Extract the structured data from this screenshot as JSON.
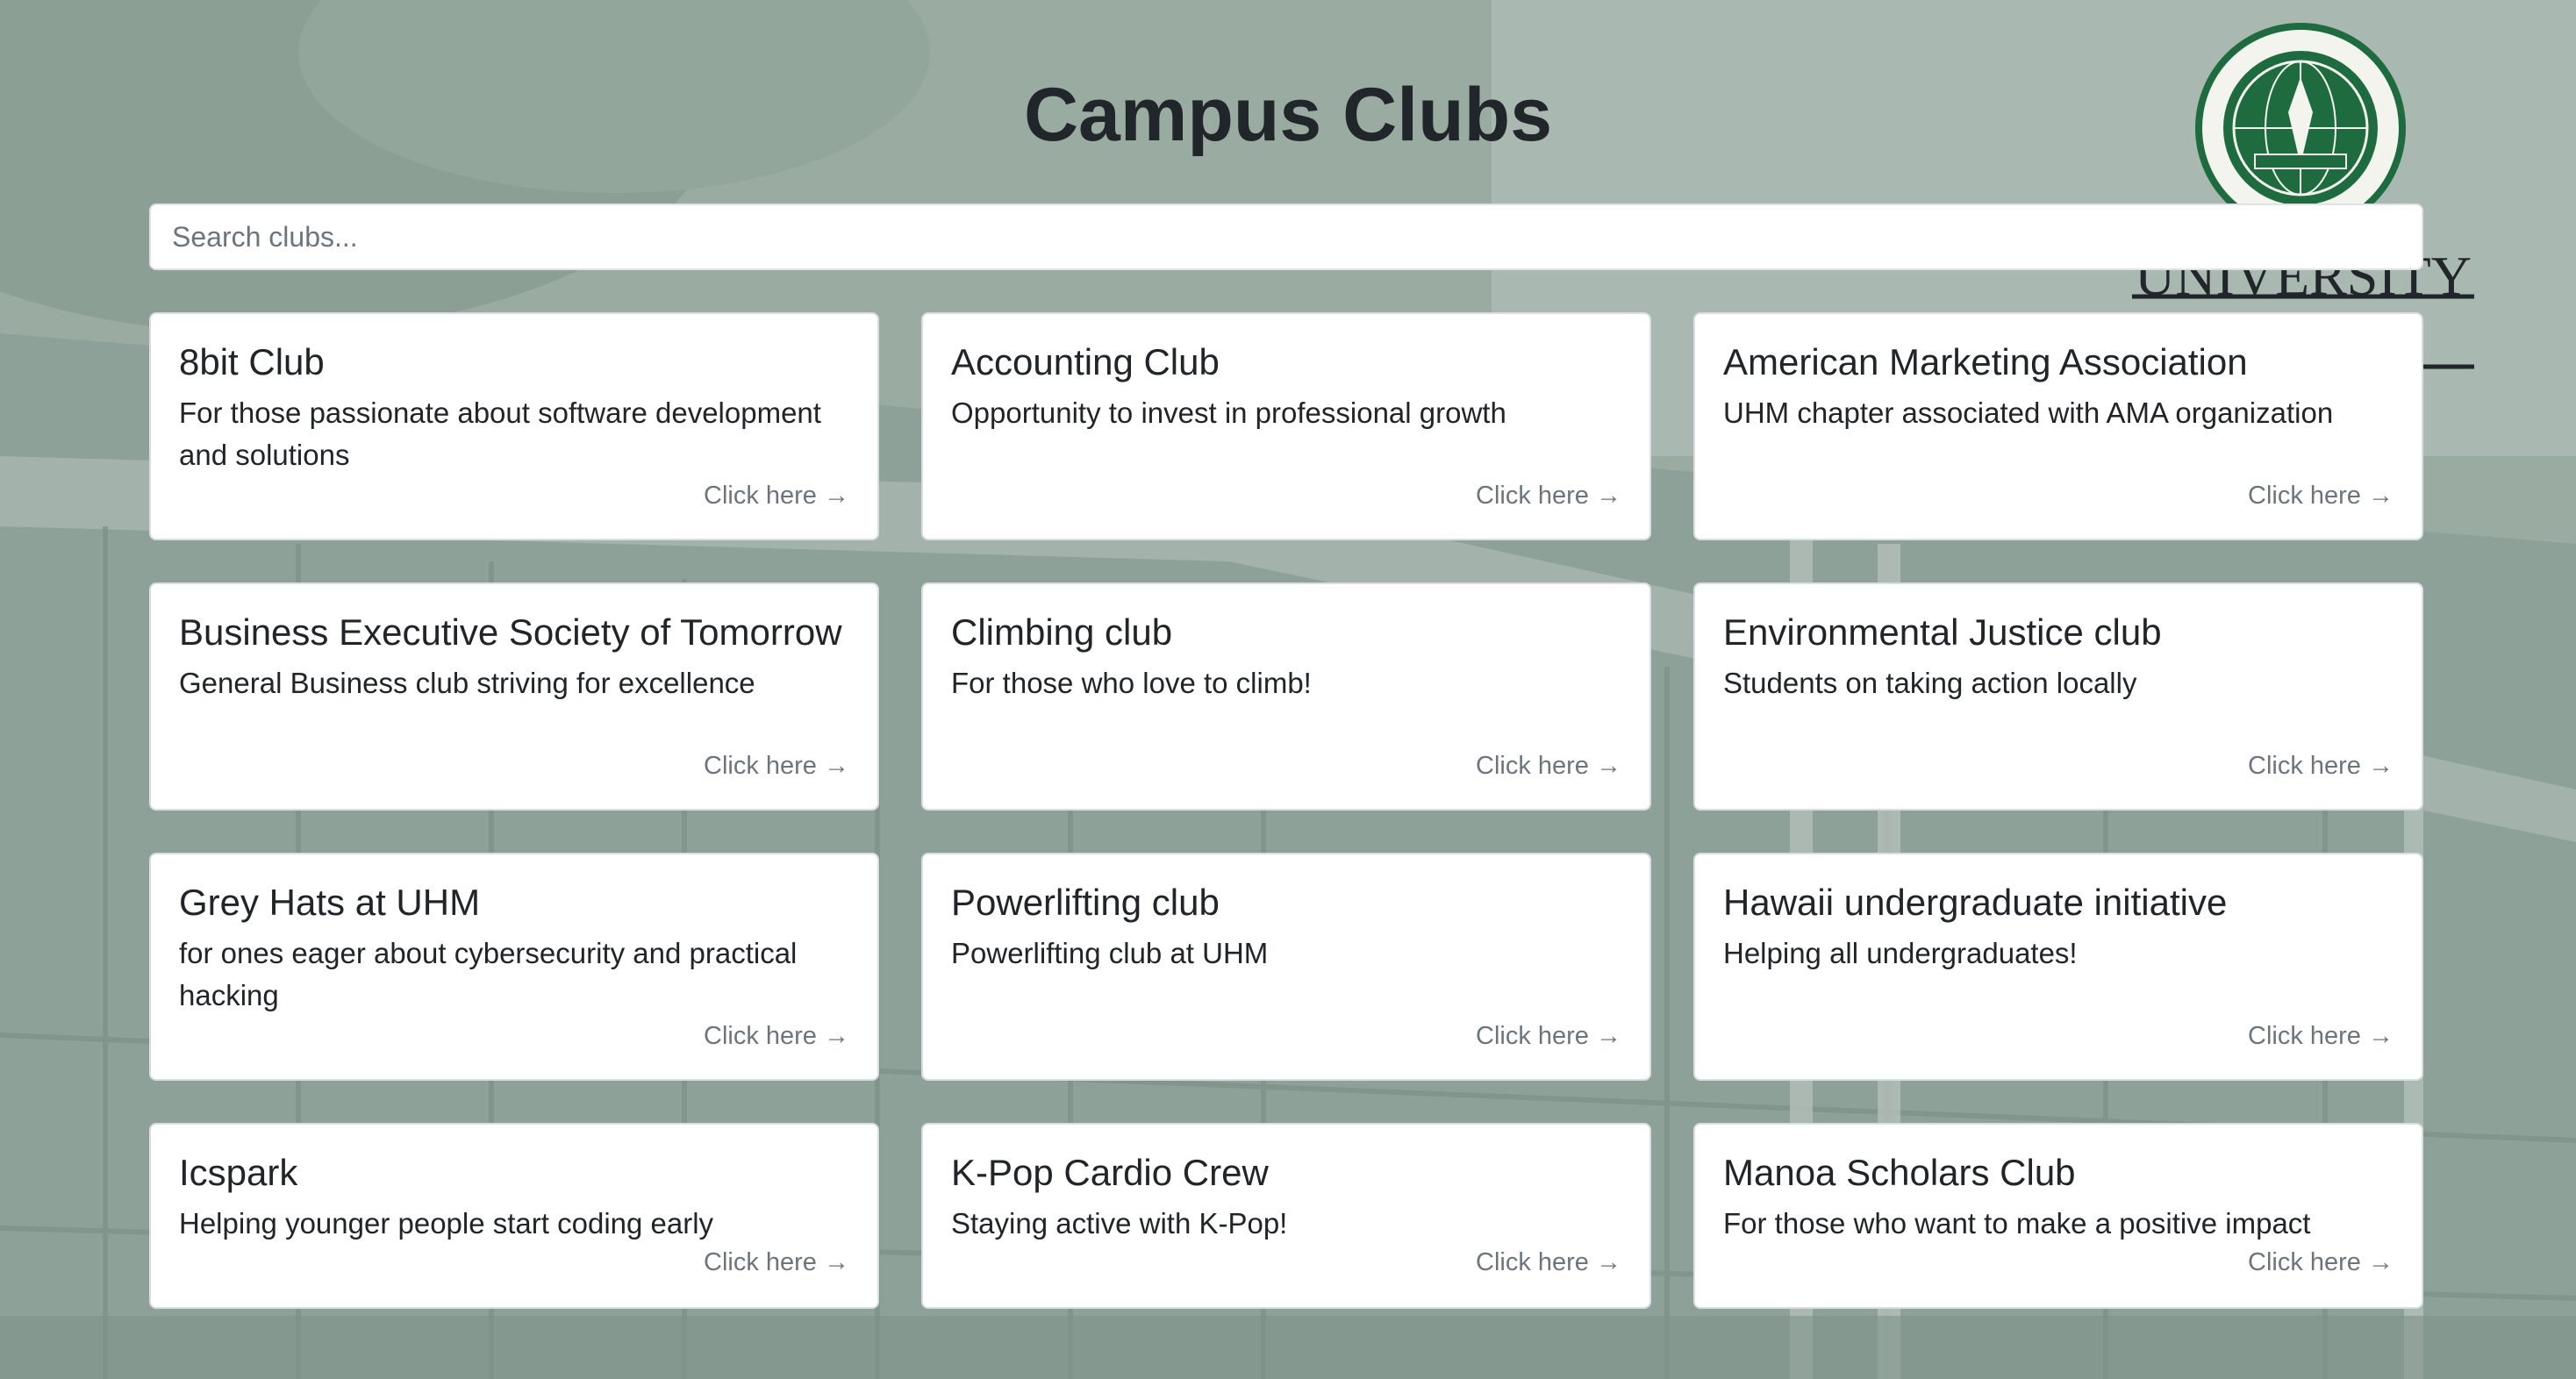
{
  "header": {
    "title": "Campus Clubs"
  },
  "search": {
    "placeholder": "Search clubs..."
  },
  "logo": {
    "name": "university-of-hawaii-seal-logo",
    "text": "UNIVERSITY of HAWAI'I"
  },
  "colors": {
    "accent": "#1e6b3f",
    "overlay": "#98aaa0",
    "muted_text": "#6c757d"
  },
  "clubs": [
    {
      "name": "8bit Club",
      "description": "For those passionate about software development and solutions",
      "link_label": "Click here →"
    },
    {
      "name": "Accounting Club",
      "description": "Opportunity to invest in professional growth",
      "link_label": "Click here →"
    },
    {
      "name": "American Marketing Association",
      "description": "UHM chapter associated with AMA organization",
      "link_label": "Click here →"
    },
    {
      "name": "Business Executive Society of Tomorrow",
      "description": "General Business club striving for excellence",
      "link_label": "Click here →"
    },
    {
      "name": "Climbing club",
      "description": "For those who love to climb!",
      "link_label": "Click here →"
    },
    {
      "name": "Environmental Justice club",
      "description": "Students on taking action locally",
      "link_label": "Click here →"
    },
    {
      "name": "Grey Hats at UHM",
      "description": "for ones eager about cybersecurity and practical hacking",
      "link_label": "Click here →"
    },
    {
      "name": "Powerlifting club",
      "description": "Powerlifting club at UHM",
      "link_label": "Click here →"
    },
    {
      "name": "Hawaii undergraduate initiative",
      "description": "Helping all undergraduates!",
      "link_label": "Click here →"
    },
    {
      "name": "Icspark",
      "description": "Helping younger people start coding early",
      "link_label": "Click here →"
    },
    {
      "name": "K-Pop Cardio Crew",
      "description": "Staying active with K-Pop!",
      "link_label": "Click here →"
    },
    {
      "name": "Manoa Scholars Club",
      "description": "For those who want to make a positive impact",
      "link_label": "Click here →"
    }
  ]
}
